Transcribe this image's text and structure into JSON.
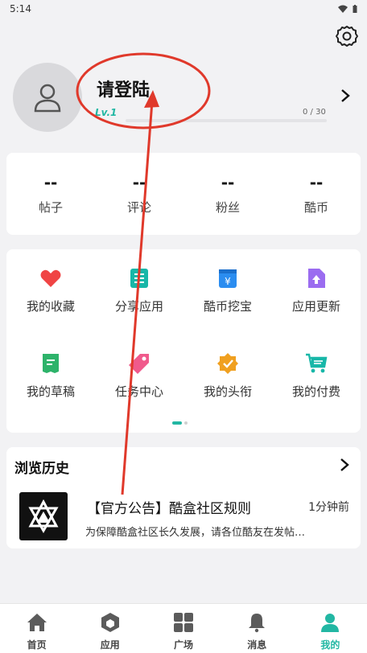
{
  "status": {
    "time": "5:14"
  },
  "profile": {
    "username": "请登陆",
    "level": "Lv.1",
    "progress_text": "0 / 30",
    "progress_fraction": 0.0
  },
  "stats": [
    {
      "value": "--",
      "label": "帖子"
    },
    {
      "value": "--",
      "label": "评论"
    },
    {
      "value": "--",
      "label": "粉丝"
    },
    {
      "value": "--",
      "label": "酷币"
    }
  ],
  "grid": {
    "items": [
      {
        "label": "我的收藏",
        "icon": "heart-icon",
        "color": "#f04444"
      },
      {
        "label": "分享应用",
        "icon": "share-app-icon",
        "color": "#18b7a8"
      },
      {
        "label": "酷币挖宝",
        "icon": "coin-treasure-icon",
        "color": "#2b8df0"
      },
      {
        "label": "应用更新",
        "icon": "update-icon",
        "color": "#9b6cf0"
      },
      {
        "label": "我的草稿",
        "icon": "draft-icon",
        "color": "#2db36a"
      },
      {
        "label": "任务中心",
        "icon": "task-tag-icon",
        "color": "#f05a8c"
      },
      {
        "label": "我的头衔",
        "icon": "badge-icon",
        "color": "#f0a020"
      },
      {
        "label": "我的付费",
        "icon": "cart-icon",
        "color": "#18b7a8"
      }
    ]
  },
  "history": {
    "header": "浏览历史",
    "item": {
      "title": "【官方公告】酷盒社区规则",
      "time": "1分钟前",
      "description": "为保障酷盒社区长久发展，请各位酷友在发帖…"
    }
  },
  "tabs": [
    {
      "label": "首页",
      "icon": "home-icon"
    },
    {
      "label": "应用",
      "icon": "apps-cube-icon"
    },
    {
      "label": "广场",
      "icon": "square-grid-icon"
    },
    {
      "label": "消息",
      "icon": "bell-icon"
    },
    {
      "label": "我的",
      "icon": "person-icon",
      "active": true
    }
  ],
  "colors": {
    "accent": "#22b7a3",
    "annotation": "#e0392b"
  }
}
